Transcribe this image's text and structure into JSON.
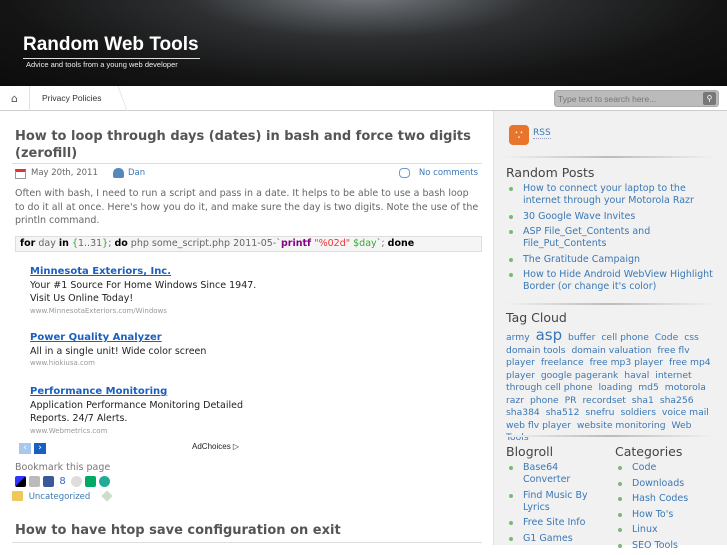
{
  "header": {
    "title": "Random Web Tools",
    "tagline": "Advice and tools from a young web developer"
  },
  "nav": {
    "home_icon": "home-icon",
    "items": [
      {
        "label": "Privacy Policies"
      }
    ]
  },
  "search": {
    "placeholder": "Type text to search here...",
    "icon": "search-icon"
  },
  "posts": [
    {
      "title": "How to loop through days (dates) in bash and force two digits (zerofill)",
      "date": "May 20th, 2011",
      "author": "Dan",
      "comments": "No comments",
      "excerpt": "Often with bash, I need to run a script and pass in a date. It helps to be able to use a bash loop to do it all at once. Here's how you do it, and make sure the day is two digits. Note the use of the println command.",
      "code": [
        {
          "t": "for",
          "c": "k"
        },
        {
          "t": " day ",
          "c": ""
        },
        {
          "t": "in",
          "c": "k"
        },
        {
          "t": " ",
          "c": ""
        },
        {
          "t": "{",
          "c": "b"
        },
        {
          "t": "1..31",
          "c": ""
        },
        {
          "t": "}",
          "c": "b"
        },
        {
          "t": "; ",
          "c": ""
        },
        {
          "t": "do",
          "c": "k"
        },
        {
          "t": " php some_script.php 2011-05-`",
          "c": ""
        },
        {
          "t": "printf",
          "c": "p"
        },
        {
          "t": " ",
          "c": ""
        },
        {
          "t": "\"%02d\"",
          "c": "s"
        },
        {
          "t": " ",
          "c": ""
        },
        {
          "t": "$day",
          "c": "v"
        },
        {
          "t": "`; ",
          "c": ""
        },
        {
          "t": "done",
          "c": "k"
        }
      ],
      "bookmark_label": "Bookmark this page",
      "category": "Uncategorized"
    },
    {
      "title": "How to have htop save configuration on exit"
    }
  ],
  "ads": [
    {
      "title": "Minnesota Exteriors, Inc.",
      "text": "Your #1 Source For Home Windows Since 1947. Visit Us Online Today!",
      "url": "www.MinnesotaExteriors.com/Windows"
    },
    {
      "title": "Power Quality Analyzer",
      "text": "All in a single unit! Wide color screen",
      "url": "www.hiokiusa.com"
    },
    {
      "title": "Performance Monitoring",
      "text": "Application Performance Monitoring Detailed Reports. 24/7 Alerts.",
      "url": "www.Webmetrics.com"
    }
  ],
  "adchoices": "AdChoices",
  "sidebar": {
    "rss": "RSS",
    "random_posts": {
      "title": "Random Posts",
      "items": [
        "How to connect your laptop to the internet through your Motorola Razr",
        "30 Google Wave Invites",
        "ASP File_Get_Contents and File_Put_Contents",
        "The Gratitude Campaign",
        "How to Hide Android WebView Highlight Border (or change it's color)"
      ]
    },
    "tag_cloud": {
      "title": "Tag Cloud",
      "tags": [
        "army",
        "asp",
        "buffer",
        "cell phone",
        "Code",
        "css",
        "domain tools",
        "domain valuation",
        "free flv player",
        "freelance",
        "free mp3 player",
        "free mp4 player",
        "google pagerank",
        "haval",
        "internet through cell phone",
        "loading",
        "md5",
        "motorola razr",
        "phone",
        "PR",
        "recordset",
        "sha1",
        "sha256",
        "sha384",
        "sha512",
        "snefru",
        "soldiers",
        "voice mail",
        "web flv player",
        "website monitoring",
        "Web Tools"
      ]
    },
    "blogroll": {
      "title": "Blogroll",
      "items": [
        "Base64 Converter",
        "Find Music By Lyrics",
        "Free Site Info",
        "G1 Games"
      ]
    },
    "categories": {
      "title": "Categories",
      "items": [
        "Code",
        "Downloads",
        "Hash Codes",
        "How To's",
        "Linux",
        "SEO Tools"
      ]
    }
  }
}
